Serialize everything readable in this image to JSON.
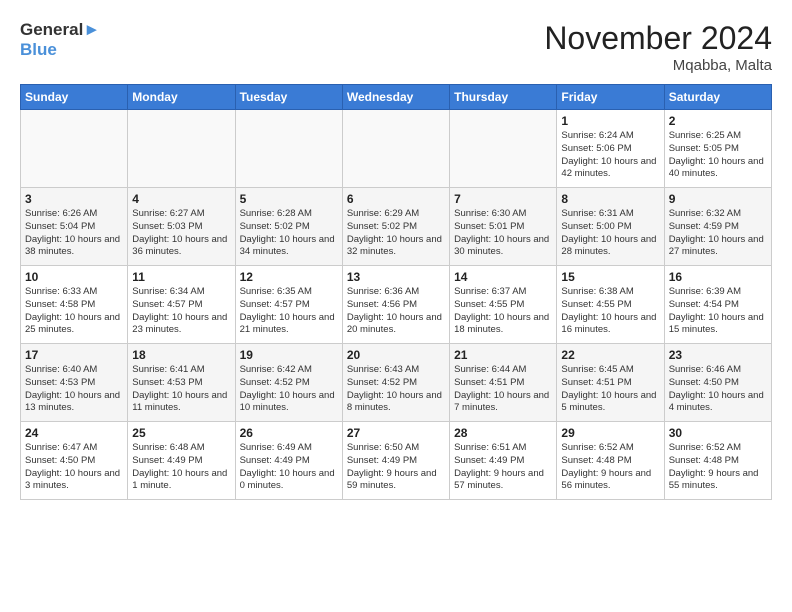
{
  "header": {
    "logo_line1": "General",
    "logo_line2": "Blue",
    "month_title": "November 2024",
    "location": "Mqabba, Malta"
  },
  "weekdays": [
    "Sunday",
    "Monday",
    "Tuesday",
    "Wednesday",
    "Thursday",
    "Friday",
    "Saturday"
  ],
  "weeks": [
    [
      {
        "day": "",
        "info": ""
      },
      {
        "day": "",
        "info": ""
      },
      {
        "day": "",
        "info": ""
      },
      {
        "day": "",
        "info": ""
      },
      {
        "day": "",
        "info": ""
      },
      {
        "day": "1",
        "info": "Sunrise: 6:24 AM\nSunset: 5:06 PM\nDaylight: 10 hours and 42 minutes."
      },
      {
        "day": "2",
        "info": "Sunrise: 6:25 AM\nSunset: 5:05 PM\nDaylight: 10 hours and 40 minutes."
      }
    ],
    [
      {
        "day": "3",
        "info": "Sunrise: 6:26 AM\nSunset: 5:04 PM\nDaylight: 10 hours and 38 minutes."
      },
      {
        "day": "4",
        "info": "Sunrise: 6:27 AM\nSunset: 5:03 PM\nDaylight: 10 hours and 36 minutes."
      },
      {
        "day": "5",
        "info": "Sunrise: 6:28 AM\nSunset: 5:02 PM\nDaylight: 10 hours and 34 minutes."
      },
      {
        "day": "6",
        "info": "Sunrise: 6:29 AM\nSunset: 5:02 PM\nDaylight: 10 hours and 32 minutes."
      },
      {
        "day": "7",
        "info": "Sunrise: 6:30 AM\nSunset: 5:01 PM\nDaylight: 10 hours and 30 minutes."
      },
      {
        "day": "8",
        "info": "Sunrise: 6:31 AM\nSunset: 5:00 PM\nDaylight: 10 hours and 28 minutes."
      },
      {
        "day": "9",
        "info": "Sunrise: 6:32 AM\nSunset: 4:59 PM\nDaylight: 10 hours and 27 minutes."
      }
    ],
    [
      {
        "day": "10",
        "info": "Sunrise: 6:33 AM\nSunset: 4:58 PM\nDaylight: 10 hours and 25 minutes."
      },
      {
        "day": "11",
        "info": "Sunrise: 6:34 AM\nSunset: 4:57 PM\nDaylight: 10 hours and 23 minutes."
      },
      {
        "day": "12",
        "info": "Sunrise: 6:35 AM\nSunset: 4:57 PM\nDaylight: 10 hours and 21 minutes."
      },
      {
        "day": "13",
        "info": "Sunrise: 6:36 AM\nSunset: 4:56 PM\nDaylight: 10 hours and 20 minutes."
      },
      {
        "day": "14",
        "info": "Sunrise: 6:37 AM\nSunset: 4:55 PM\nDaylight: 10 hours and 18 minutes."
      },
      {
        "day": "15",
        "info": "Sunrise: 6:38 AM\nSunset: 4:55 PM\nDaylight: 10 hours and 16 minutes."
      },
      {
        "day": "16",
        "info": "Sunrise: 6:39 AM\nSunset: 4:54 PM\nDaylight: 10 hours and 15 minutes."
      }
    ],
    [
      {
        "day": "17",
        "info": "Sunrise: 6:40 AM\nSunset: 4:53 PM\nDaylight: 10 hours and 13 minutes."
      },
      {
        "day": "18",
        "info": "Sunrise: 6:41 AM\nSunset: 4:53 PM\nDaylight: 10 hours and 11 minutes."
      },
      {
        "day": "19",
        "info": "Sunrise: 6:42 AM\nSunset: 4:52 PM\nDaylight: 10 hours and 10 minutes."
      },
      {
        "day": "20",
        "info": "Sunrise: 6:43 AM\nSunset: 4:52 PM\nDaylight: 10 hours and 8 minutes."
      },
      {
        "day": "21",
        "info": "Sunrise: 6:44 AM\nSunset: 4:51 PM\nDaylight: 10 hours and 7 minutes."
      },
      {
        "day": "22",
        "info": "Sunrise: 6:45 AM\nSunset: 4:51 PM\nDaylight: 10 hours and 5 minutes."
      },
      {
        "day": "23",
        "info": "Sunrise: 6:46 AM\nSunset: 4:50 PM\nDaylight: 10 hours and 4 minutes."
      }
    ],
    [
      {
        "day": "24",
        "info": "Sunrise: 6:47 AM\nSunset: 4:50 PM\nDaylight: 10 hours and 3 minutes."
      },
      {
        "day": "25",
        "info": "Sunrise: 6:48 AM\nSunset: 4:49 PM\nDaylight: 10 hours and 1 minute."
      },
      {
        "day": "26",
        "info": "Sunrise: 6:49 AM\nSunset: 4:49 PM\nDaylight: 10 hours and 0 minutes."
      },
      {
        "day": "27",
        "info": "Sunrise: 6:50 AM\nSunset: 4:49 PM\nDaylight: 9 hours and 59 minutes."
      },
      {
        "day": "28",
        "info": "Sunrise: 6:51 AM\nSunset: 4:49 PM\nDaylight: 9 hours and 57 minutes."
      },
      {
        "day": "29",
        "info": "Sunrise: 6:52 AM\nSunset: 4:48 PM\nDaylight: 9 hours and 56 minutes."
      },
      {
        "day": "30",
        "info": "Sunrise: 6:52 AM\nSunset: 4:48 PM\nDaylight: 9 hours and 55 minutes."
      }
    ]
  ]
}
